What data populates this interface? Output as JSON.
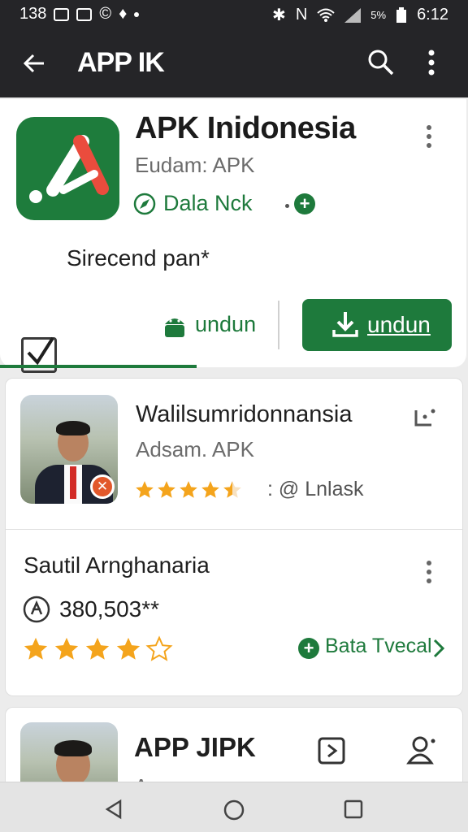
{
  "status_bar": {
    "time_left": "138",
    "time_right": "6:12",
    "battery_text": "5%"
  },
  "app_bar": {
    "title": "APP IK"
  },
  "featured": {
    "title": "APK Inidonesia",
    "subtitle": "Eudam: APK",
    "link_label": "Dala Nck",
    "checkbox_label": "Sirecend pan*",
    "secondary_button_label": "undun",
    "primary_button_label": "undun"
  },
  "entry1": {
    "title": "Walilsumridonnansia",
    "subtitle": "Adsam. APK",
    "rating_stars": 4.5,
    "rating_label": ": @ Lnlask"
  },
  "entry2": {
    "title": "Sautil Arnghanaria",
    "downloads": "380,503**",
    "rating_stars": 4,
    "action_label": "Bata Tvecal"
  },
  "entry3": {
    "title": "APP JIPK",
    "subtitle_partial": "A..."
  },
  "colors": {
    "brand_green": "#1e7a3c",
    "star_orange": "#f4a41c",
    "app_bar": "#252528",
    "badge_orange": "#e2582b"
  },
  "icons": [
    "back-arrow-icon",
    "search-icon",
    "more-vert-icon",
    "download-icon",
    "android-icon",
    "plus-icon",
    "user-icon",
    "share-icon"
  ]
}
